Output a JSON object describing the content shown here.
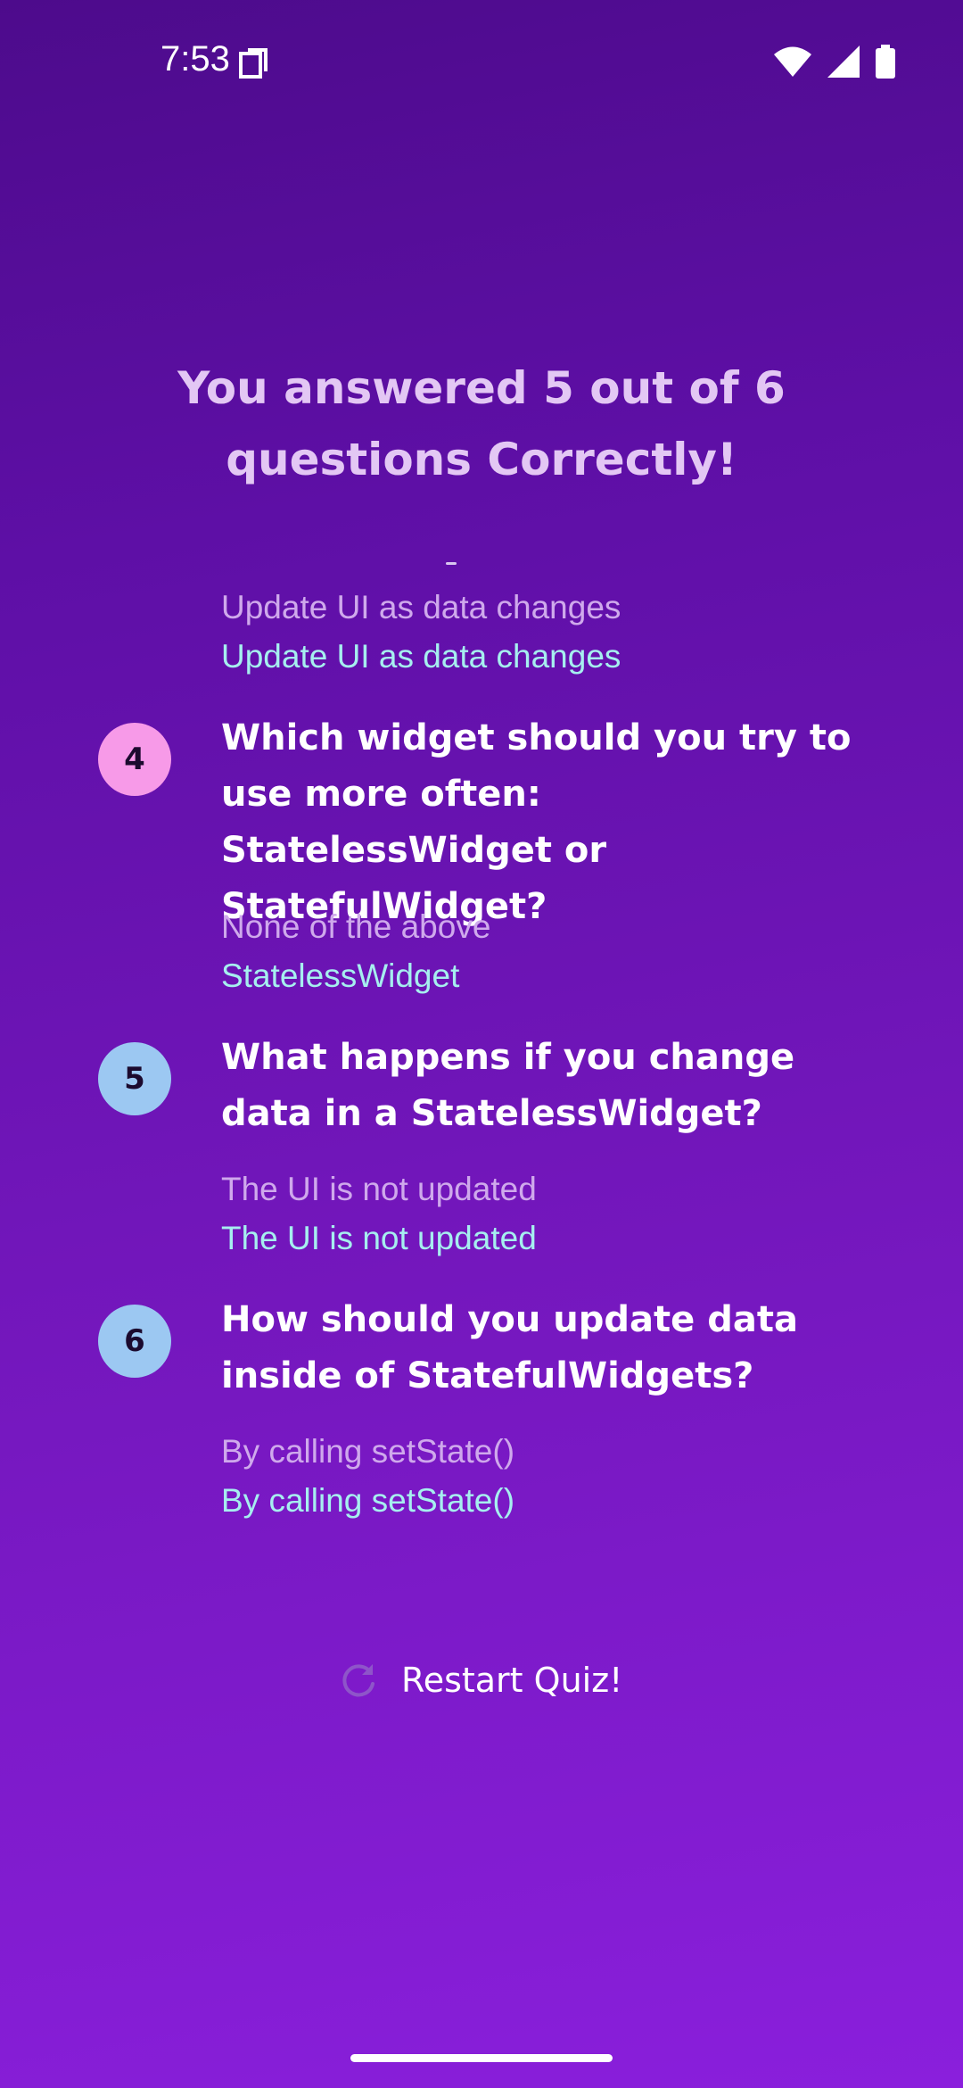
{
  "status_bar": {
    "time": "7:53",
    "icons": [
      "copy-icon",
      "wifi-icon",
      "cellular-signal-icon",
      "battery-icon"
    ]
  },
  "results": {
    "title": "You answered 5 out of 6 questions Correctly!"
  },
  "summary": [
    {
      "number": "",
      "question": "",
      "user_answer": "Update UI as data changes",
      "correct_answer": "Update UI as data changes",
      "is_correct": true
    },
    {
      "number": "4",
      "question": "Which widget should you try to use more often: StatelessWidget or StatefulWidget?",
      "user_answer": "None of the above",
      "correct_answer": "StatelessWidget",
      "is_correct": false
    },
    {
      "number": "5",
      "question": "What happens if you change data in a StatelessWidget?",
      "user_answer": "The UI is not updated",
      "correct_answer": "The UI is not updated",
      "is_correct": true
    },
    {
      "number": "6",
      "question": "How should you update data inside of StatefulWidgets?",
      "user_answer": "By calling setState()",
      "correct_answer": "By calling setState()",
      "is_correct": true
    }
  ],
  "restart": {
    "label": "Restart Quiz!",
    "icon": "refresh-icon"
  },
  "colors": {
    "background_top": "#4d0b8c",
    "background_bottom": "#8a1fdc",
    "title": "#e3c7f4",
    "wrong_badge": "#f79ae8",
    "correct_badge": "#9cc8f2",
    "user_answer": "#cfa9ec",
    "correct_answer": "#a6efef"
  }
}
